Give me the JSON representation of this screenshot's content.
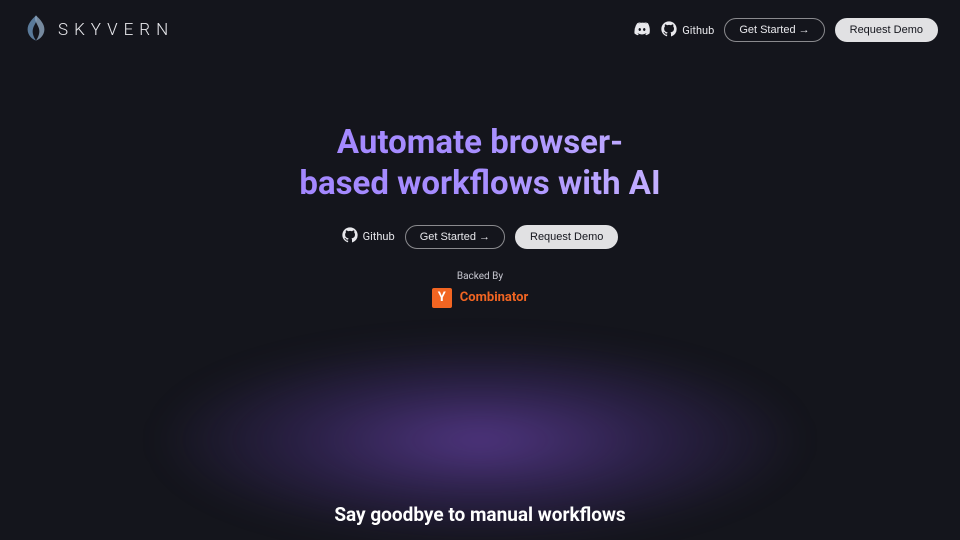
{
  "brand": {
    "name": "SKYVERN"
  },
  "nav": {
    "github": "Github",
    "get_started": "Get Started →",
    "request_demo": "Request Demo"
  },
  "hero": {
    "title_line1": "Automate browser-",
    "title_line2": "based workflows with AI",
    "github": "Github",
    "get_started": "Get Started →",
    "request_demo": "Request Demo"
  },
  "backed": {
    "label": "Backed By",
    "yc_letter": "Y",
    "yc_name": "Combinator"
  },
  "subhead": "Say goodbye to manual workflows"
}
